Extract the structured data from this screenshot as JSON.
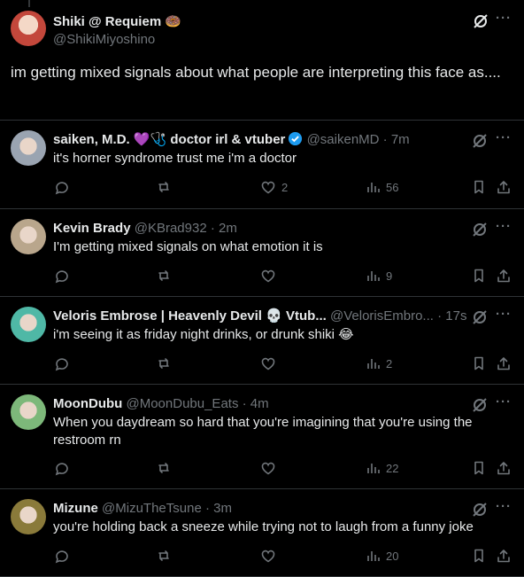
{
  "main_post": {
    "author_name": "Shiki @ Requiem 🍩",
    "handle": "@ShikiMiyoshino",
    "text": "im getting mixed signals about what people are interpreting this face as...."
  },
  "replies": [
    {
      "name": "saiken, M.D. 💜🩺 doctor irl & vtuber",
      "handle": "@saikenMD",
      "time": "7m",
      "text": "it's horner syndrome trust me i'm a doctor",
      "likes": "2",
      "views": "56",
      "verified": true,
      "avatar_color": "#9aa4b1"
    },
    {
      "name": "Kevin Brady",
      "handle": "@KBrad932",
      "time": "2m",
      "text": "I'm getting mixed signals on what emotion it is",
      "likes": "",
      "views": "9",
      "verified": false,
      "avatar_color": "#b9a68c"
    },
    {
      "name": "Veloris Embrose | Heavenly Devil 💀 Vtub...",
      "handle": "@VelorisEmbro...",
      "time": "17s",
      "text": "i'm seeing it as friday night drinks, or drunk shiki 😂",
      "likes": "",
      "views": "2",
      "verified": false,
      "avatar_color": "#4fb8a6"
    },
    {
      "name": "MoonDubu",
      "handle": "@MoonDubu_Eats",
      "time": "4m",
      "text": "When you daydream so hard that you're imagining that you're using the restroom rn",
      "likes": "",
      "views": "22",
      "verified": false,
      "avatar_color": "#7db87a"
    },
    {
      "name": "Mizune",
      "handle": "@MizuTheTsune",
      "time": "3m",
      "text": "you're holding back a sneeze while trying not to laugh from a funny joke",
      "likes": "",
      "views": "20",
      "verified": false,
      "avatar_color": "#8a7a3a"
    }
  ],
  "meta_separator": "·",
  "more_glyph": "···",
  "colors": {
    "background": "#000000",
    "text": "#e7e9ea",
    "muted": "#71767b",
    "border": "#2f3336",
    "verified": "#1d9bf0"
  },
  "icons": [
    "grok-icon",
    "more-icon",
    "reply-icon",
    "retweet-icon",
    "like-icon",
    "views-icon",
    "bookmark-icon",
    "share-icon",
    "verified-badge-icon"
  ]
}
